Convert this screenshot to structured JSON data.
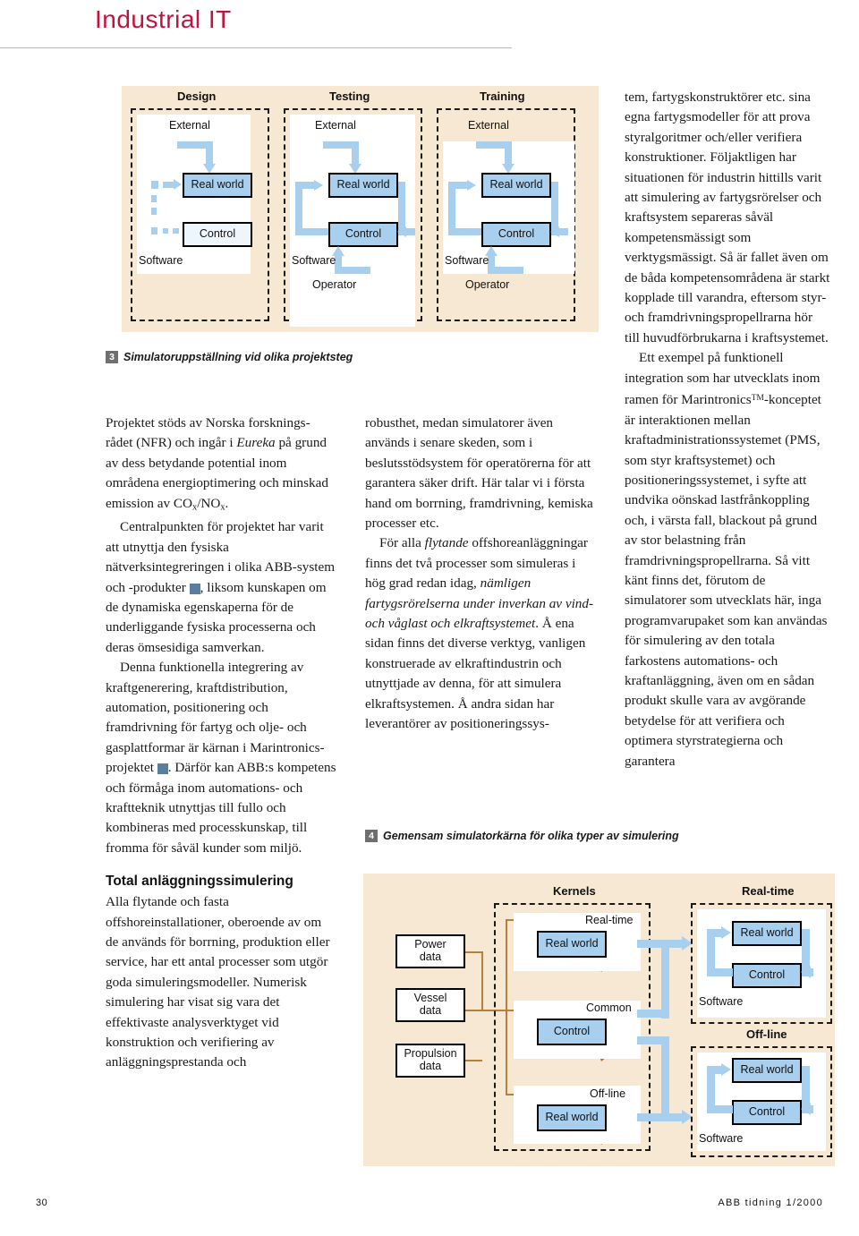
{
  "header": {
    "title": "Industrial IT"
  },
  "figure3": {
    "caption_number": "3",
    "caption_text": "Simulatoruppställning vid olika projektsteg",
    "panels": [
      {
        "title": "Design",
        "external": "External",
        "real_world": "Real world",
        "control": "Control",
        "software": "Software",
        "operator": ""
      },
      {
        "title": "Testing",
        "external": "External",
        "real_world": "Real world",
        "control": "Control",
        "software": "Software",
        "operator": "Operator"
      },
      {
        "title": "Training",
        "external": "External",
        "real_world": "Real world",
        "control": "Control",
        "software": "Software",
        "operator": "Operator"
      }
    ]
  },
  "figure4": {
    "caption_number": "4",
    "caption_text": "Gemensam simulatorkärna för olika typer av simulering",
    "data_boxes": [
      {
        "line1": "Power",
        "line2": "data"
      },
      {
        "line1": "Vessel",
        "line2": "data"
      },
      {
        "line1": "Propulsion",
        "line2": "data"
      }
    ],
    "kernels_title": "Kernels",
    "kernels": [
      {
        "label": "Real-time",
        "box": "Real world"
      },
      {
        "label": "Common",
        "box": "Control"
      },
      {
        "label": "Off-line",
        "box": "Real world"
      }
    ],
    "targets": [
      {
        "title": "Real-time",
        "real_world": "Real world",
        "control": "Control",
        "software": "Software"
      },
      {
        "title": "Off-line",
        "real_world": "Real world",
        "control": "Control",
        "software": "Software"
      }
    ]
  },
  "column1": {
    "p1_a": "Projektet stöds av Norska forsknings-rådet (NFR) och ingår i ",
    "p1_em": "Eureka",
    "p1_b": " på grund av dess betydande potential inom områdena energioptimering och minskad emission av CO",
    "p1_sub1": "x",
    "p1_c": "/NO",
    "p1_sub2": "x",
    "p1_d": ".",
    "p2_a": "Centralpunkten för projektet har varit att utnyttja den fysiska nätverksintegreringen i olika ABB-system och -produkter ",
    "p2_ref": "1",
    "p2_b": ", liksom kunskapen om de dynamiska egenskaperna för de underliggande fysiska processerna och deras ömsesidiga samverkan.",
    "p3_a": "Denna funktionella integrering av kraftgenerering, kraftdistribution, automation, positionering och framdrivning för fartyg och olje- och gasplattformar är kärnan i Marintronics-projektet ",
    "p3_ref": "2",
    "p3_b": ". Därför kan ABB:s kompetens och förmåga inom automations- och kraftteknik utnyttjas till fullo och kombineras med processkunskap, till fromma för såväl kunder som miljö.",
    "subhead": "Total anläggningssimulering",
    "p4": "Alla flytande och fasta offshoreinstallationer, oberoende av om de används för borrning, produktion eller service, har ett antal processer som utgör goda simuleringsmodeller. Numerisk simulering har visat sig vara det effektivaste analysverktyget vid konstruktion och verifiering av anläggningsprestanda och"
  },
  "column2": {
    "p1": "robusthet, medan simulatorer även används i senare skeden, som i beslutsstödsystem för operatörerna för att garantera säker drift. Här talar vi i första hand om borrning, framdrivning, kemiska processer etc.",
    "p2_a": "För alla ",
    "p2_em1": "flytande",
    "p2_b": " offshoreanläggningar finns det två processer som simuleras i hög grad redan idag, ",
    "p2_em2": "nämligen fartygsrörelserna under inverkan av vind- och våglast och elkraftsystemet",
    "p2_c": ". Å ena sidan finns det diverse verktyg, vanligen konstruerade av elkraftindustrin och utnyttjade av denna, för att simulera elkraftsystemen. Å andra sidan har leverantörer av positioneringssys-"
  },
  "column3": {
    "p1": "tem, fartygskonstruktörer etc. sina egna fartygsmodeller för att prova styralgoritmer och/eller verifiera konstruktioner. Följaktligen har situationen för industrin hittills varit att simulering av fartygsrörelser och kraftsystem separeras såväl kompetensmässigt som verktygsmässigt. Så är fallet även om de båda kompetensområdena är starkt kopplade till varandra, eftersom styr- och framdrivningspropellrarna hör till huvudförbrukarna i kraftsystemet.",
    "p2_a": "Ett exempel på funktionell integration som har utvecklats inom ramen för Marintronics",
    "p2_tm": "TM",
    "p2_b": "-konceptet är interaktionen mellan kraftadministrationssystemet (PMS, som styr kraftsystemet) och positioneringssystemet, i syfte att undvika oönskad lastfrånkoppling och, i värsta fall, blackout på grund av stor belastning från framdrivningspropellrarna. Så vitt känt finns det, förutom de simulatorer som utvecklats här, inga programvarupaket som kan användas för simulering av den totala farkostens automations- och kraftanläggning, även om en sådan produkt skulle vara av avgörande betydelse för att verifiera och optimera styrstrategierna och garantera"
  },
  "footer": {
    "page": "30",
    "source": "ABB tidning 1/2000"
  }
}
